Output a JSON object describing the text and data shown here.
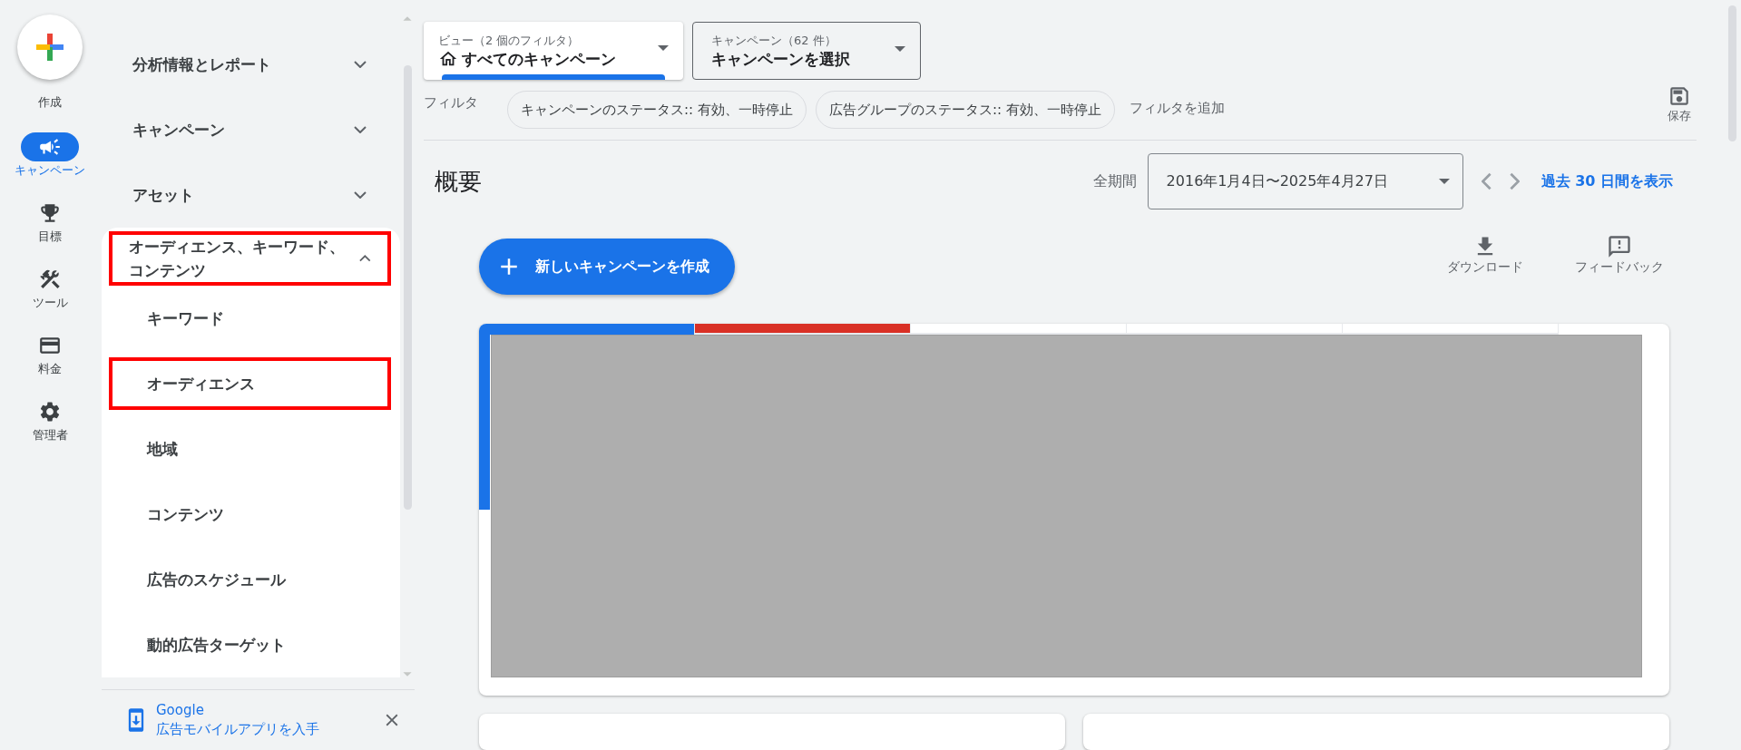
{
  "rail": {
    "create": "作成",
    "items": [
      {
        "label": "キャンペーン",
        "selected": true
      },
      {
        "label": "目標",
        "selected": false
      },
      {
        "label": "ツール",
        "selected": false
      },
      {
        "label": "料金",
        "selected": false
      },
      {
        "label": "管理者",
        "selected": false
      }
    ]
  },
  "sidebar": {
    "items": [
      {
        "label": "分析情報とレポート",
        "expanded": false,
        "highlighted": false
      },
      {
        "label": "キャンペーン",
        "expanded": false,
        "highlighted": false
      },
      {
        "label": "アセット",
        "expanded": false,
        "highlighted": false
      },
      {
        "label": "オーディエンス、キーワード、コンテンツ",
        "expanded": true,
        "highlighted": true,
        "children": [
          {
            "label": "キーワード",
            "highlighted": false
          },
          {
            "label": "オーディエンス",
            "highlighted": true
          },
          {
            "label": "地域",
            "highlighted": false
          },
          {
            "label": "コンテンツ",
            "highlighted": false
          },
          {
            "label": "広告のスケジュール",
            "highlighted": false
          },
          {
            "label": "動的広告ターゲット",
            "highlighted": false
          }
        ]
      }
    ],
    "promo": {
      "line_1": "Google",
      "line_2": "広告モバイルアプリを入手"
    }
  },
  "toolbar": {
    "view": {
      "label": "ビュー（2 個のフィルタ）",
      "value": "すべてのキャンペーン"
    },
    "campaign": {
      "label": "キャンペーン（62 件）",
      "value": "キャンペーンを選択"
    },
    "filter_label": "フィルタ",
    "filters": [
      "キャンペーンのステータス:: 有効、一時停止",
      "広告グループのステータス:: 有効、一時停止"
    ],
    "add_filter": "フィルタを追加",
    "save": "保存"
  },
  "overview": {
    "title": "概要",
    "period_label": "全期間",
    "date_range": "2016年1月4日〜2025年4月27日",
    "last_30_link": "過去 30 日間を表示",
    "new_campaign": "新しいキャンペーンを作成",
    "download": "ダウンロード",
    "feedback": "フィードバック",
    "metric_tabs": [
      {
        "selected": true,
        "color": "#1a73e8"
      },
      {
        "selected": false,
        "color": "#d93025"
      },
      {
        "selected": false,
        "color": "#ffffff"
      },
      {
        "selected": false,
        "color": "#ffffff"
      },
      {
        "selected": false,
        "color": "#ffffff"
      }
    ]
  }
}
